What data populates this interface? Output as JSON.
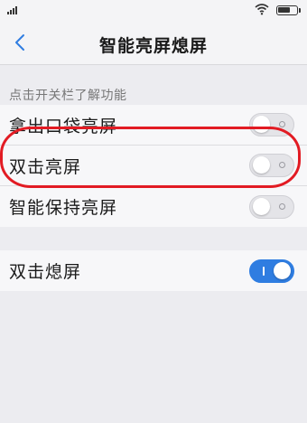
{
  "status_bar": {
    "signal_icon": "signal-icon",
    "wifi_icon": "wifi-icon",
    "battery_icon": "battery-icon",
    "battery_level": 0.7
  },
  "nav": {
    "back_icon": "chevron-left-icon",
    "title": "智能亮屏熄屏"
  },
  "section_header": "点击开关栏了解功能",
  "rows_group1": [
    {
      "label": "拿出口袋亮屏",
      "enabled": false
    },
    {
      "label": "双击亮屏",
      "enabled": false
    },
    {
      "label": "智能保持亮屏",
      "enabled": false
    }
  ],
  "rows_group2": [
    {
      "label": "双击熄屏",
      "enabled": true
    }
  ],
  "colors": {
    "accent": "#2f7de1",
    "annotation": "#e21b23"
  }
}
